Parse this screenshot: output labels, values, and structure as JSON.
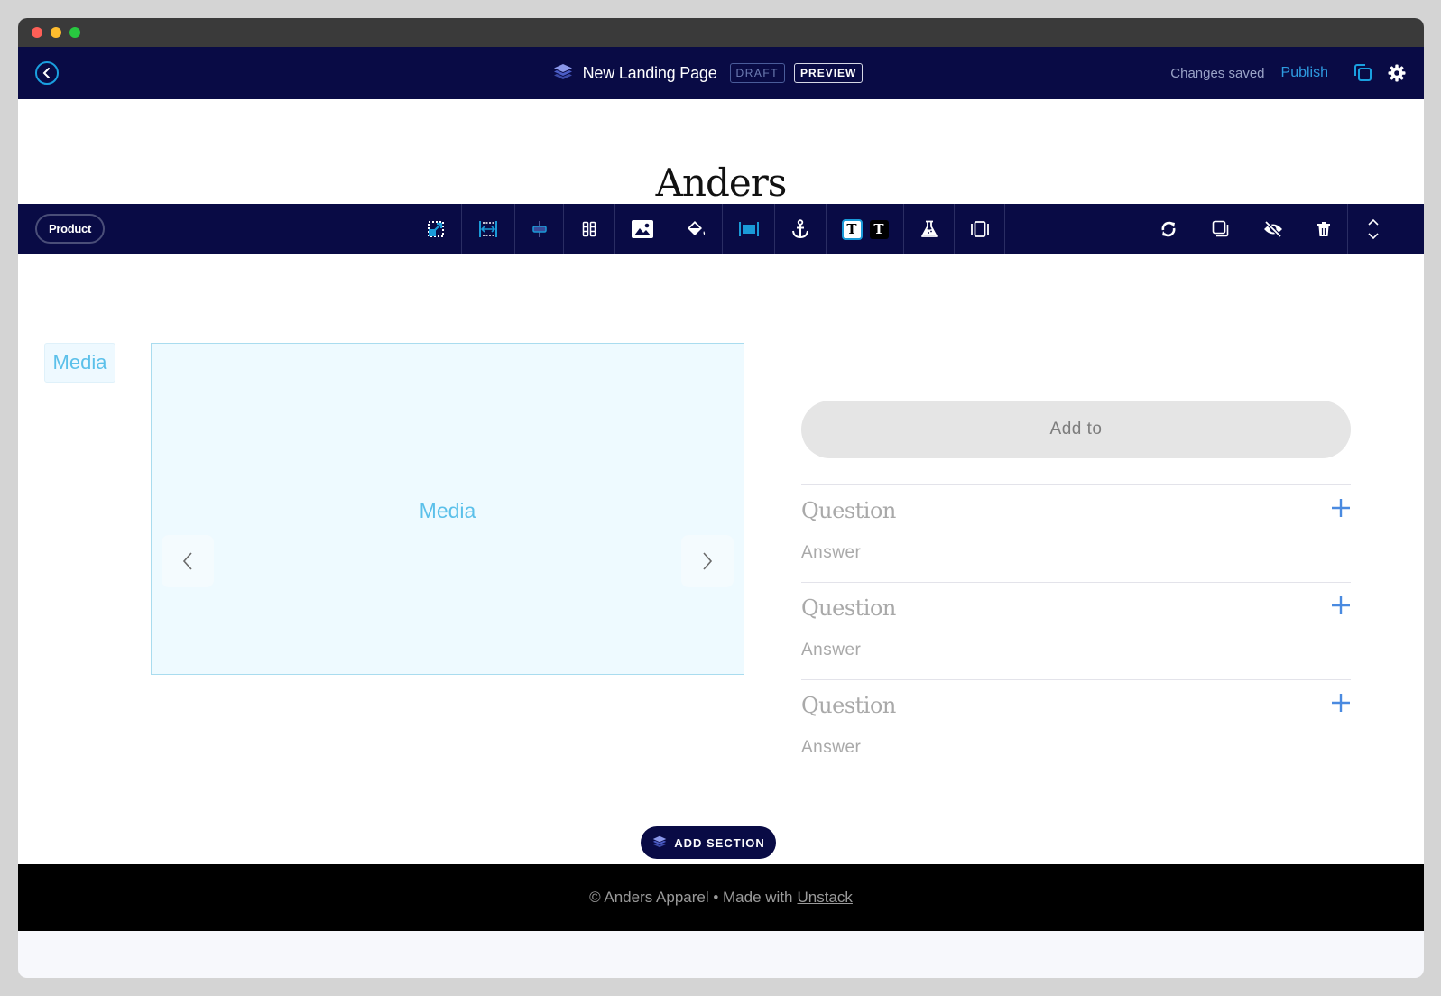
{
  "window": {
    "controls": [
      "close",
      "minimize",
      "maximize"
    ],
    "colors": {
      "close": "#fe5f57",
      "minimize": "#febc2e",
      "maximize": "#28c840"
    }
  },
  "appbar": {
    "back_icon": "chevron-left-circle-icon",
    "page_title": "New Landing Page",
    "status_badge": "DRAFT",
    "preview_label": "PREVIEW",
    "save_status": "Changes saved",
    "publish_label": "Publish",
    "copy_icon": "duplicate-icon",
    "settings_icon": "gear-icon",
    "accent": "#1aa0e0",
    "background": "#090b45"
  },
  "page": {
    "brand": "Anders"
  },
  "toolbar": {
    "section_label": "Product",
    "tools": [
      {
        "name": "resize-icon",
        "label": "Resize"
      },
      {
        "name": "width-icon",
        "label": "Width"
      },
      {
        "name": "vertical-align-icon",
        "label": "Alignment"
      },
      {
        "name": "columns-icon",
        "label": "Columns"
      },
      {
        "name": "image-icon",
        "label": "Background image"
      },
      {
        "name": "paint-bucket-icon",
        "label": "Background color"
      },
      {
        "name": "full-width-icon",
        "label": "Full width"
      },
      {
        "name": "anchor-icon",
        "label": "Anchor"
      },
      {
        "name": "text-light-icon",
        "label": "Light text"
      },
      {
        "name": "text-dark-icon",
        "label": "Dark text"
      },
      {
        "name": "flask-icon",
        "label": "Experiment"
      },
      {
        "name": "carousel-icon",
        "label": "Layout"
      }
    ],
    "actions": [
      {
        "name": "refresh-icon",
        "label": "Refresh"
      },
      {
        "name": "duplicate-icon",
        "label": "Duplicate"
      },
      {
        "name": "hide-icon",
        "label": "Hide"
      },
      {
        "name": "trash-icon",
        "label": "Delete"
      }
    ],
    "reorder_icons": [
      "chevron-up-icon",
      "chevron-down-icon"
    ]
  },
  "product": {
    "media_tag": "Media",
    "media_placeholder": "Media",
    "add_to_cart": "Add to",
    "faqs": [
      {
        "question": "Question",
        "answer": "Answer"
      },
      {
        "question": "Question",
        "answer": "Answer"
      },
      {
        "question": "Question",
        "answer": "Answer"
      }
    ]
  },
  "add_section_label": "ADD SECTION",
  "footer": {
    "text": "© Anders Apparel • Made with",
    "link": "Unstack"
  }
}
